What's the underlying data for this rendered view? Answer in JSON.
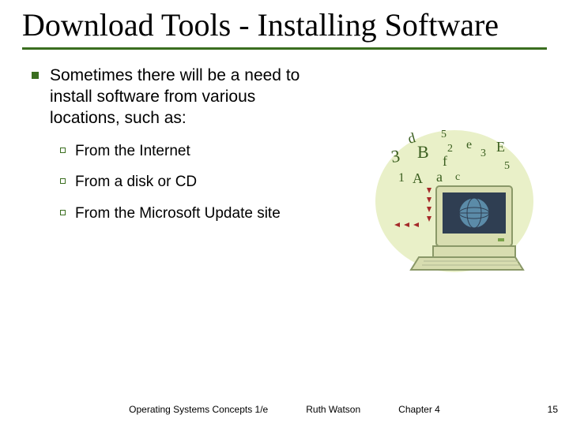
{
  "title": "Download Tools - Installing Software",
  "intro": "Sometimes there will be a need to install software from various locations, such as:",
  "sub": {
    "a": "From the Internet",
    "b": "From a disk or CD",
    "c": "From the Microsoft Update site"
  },
  "footer": {
    "book": "Operating Systems Concepts 1/e",
    "author": "Ruth Watson",
    "chapter": "Chapter 4"
  },
  "pagenum": "15"
}
